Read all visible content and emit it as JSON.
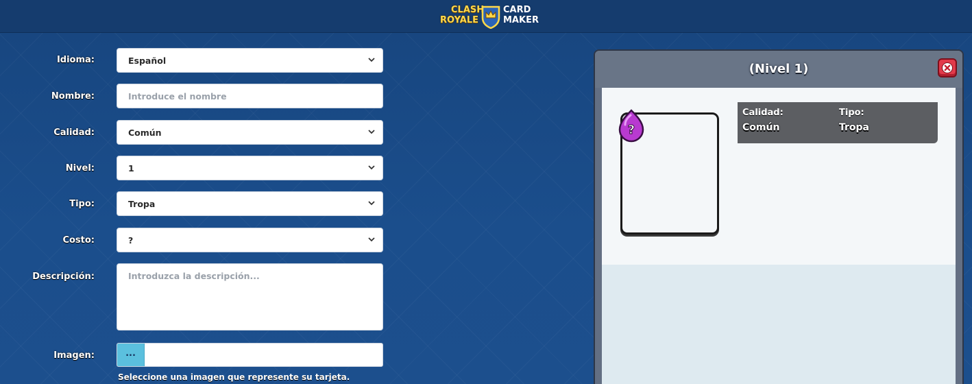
{
  "header": {
    "logo": {
      "word_top_left": "CLASH",
      "word_bottom_left": "ROYALE",
      "word_top_right": "CARD",
      "word_bottom_right": "MAKER"
    }
  },
  "form": {
    "language": {
      "label": "Idioma:",
      "value": "Español"
    },
    "name": {
      "label": "Nombre:",
      "placeholder": "Introduce el nombre"
    },
    "quality": {
      "label": "Calidad:",
      "value": "Común"
    },
    "level": {
      "label": "Nivel:",
      "value": "1"
    },
    "type": {
      "label": "Tipo:",
      "value": "Tropa"
    },
    "cost": {
      "label": "Costo:",
      "value": "?"
    },
    "description": {
      "label": "Descripción:",
      "placeholder": "Introduzca la descripción..."
    },
    "image": {
      "label": "Imagen:",
      "button_label": "...",
      "help_text": "Seleccione una imagen que represente su tarjeta."
    }
  },
  "preview": {
    "title": "(Nivel 1)",
    "elixir_cost": "?",
    "info": {
      "quality_label": "Calidad:",
      "quality_value": "Común",
      "type_label": "Tipo:",
      "type_value": "Tropa"
    }
  },
  "colors": {
    "background": "#1a4a84",
    "file_button": "#5bc0de",
    "close_button": "#e23a4a",
    "elixir": "#b83ad0"
  }
}
